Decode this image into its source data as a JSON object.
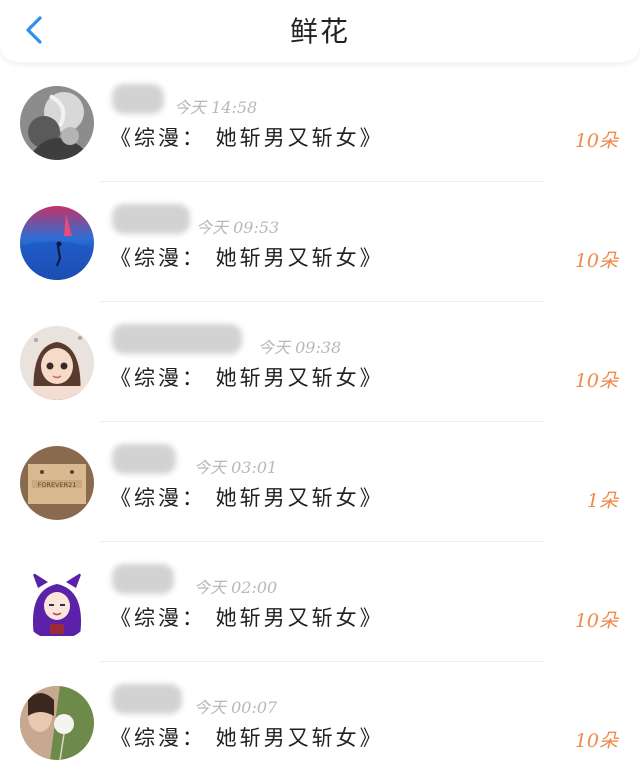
{
  "header": {
    "title": "鲜花",
    "accent_color": "#2e90ee",
    "back_icon": "chevron-left-icon"
  },
  "colors": {
    "amount": "#f08a4b",
    "time": "#b8b8b8",
    "text": "#222222"
  },
  "items": [
    {
      "time": "今天 14:58",
      "book": "《综漫： 她斩男又斩女》",
      "amount": "10朵",
      "avatar": "grey-sketch-portrait"
    },
    {
      "time": "今天 09:53",
      "book": "《综漫： 她斩男又斩女》",
      "amount": "10朵",
      "avatar": "blue-ocean-figure"
    },
    {
      "time": "今天 09:38",
      "book": "《综漫： 她斩男又斩女》",
      "amount": "10朵",
      "avatar": "chibi-girl"
    },
    {
      "time": "今天 03:01",
      "book": "《综漫： 她斩男又斩女》",
      "amount": "1朵",
      "avatar": "forever21-tag"
    },
    {
      "time": "今天 02:00",
      "book": "《综漫： 她斩男又斩女》",
      "amount": "10朵",
      "avatar": "purple-hair-anime"
    },
    {
      "time": "今天 00:07",
      "book": "《综漫： 她斩男又斩女》",
      "amount": "10朵",
      "avatar": "dandelion-photo"
    }
  ]
}
